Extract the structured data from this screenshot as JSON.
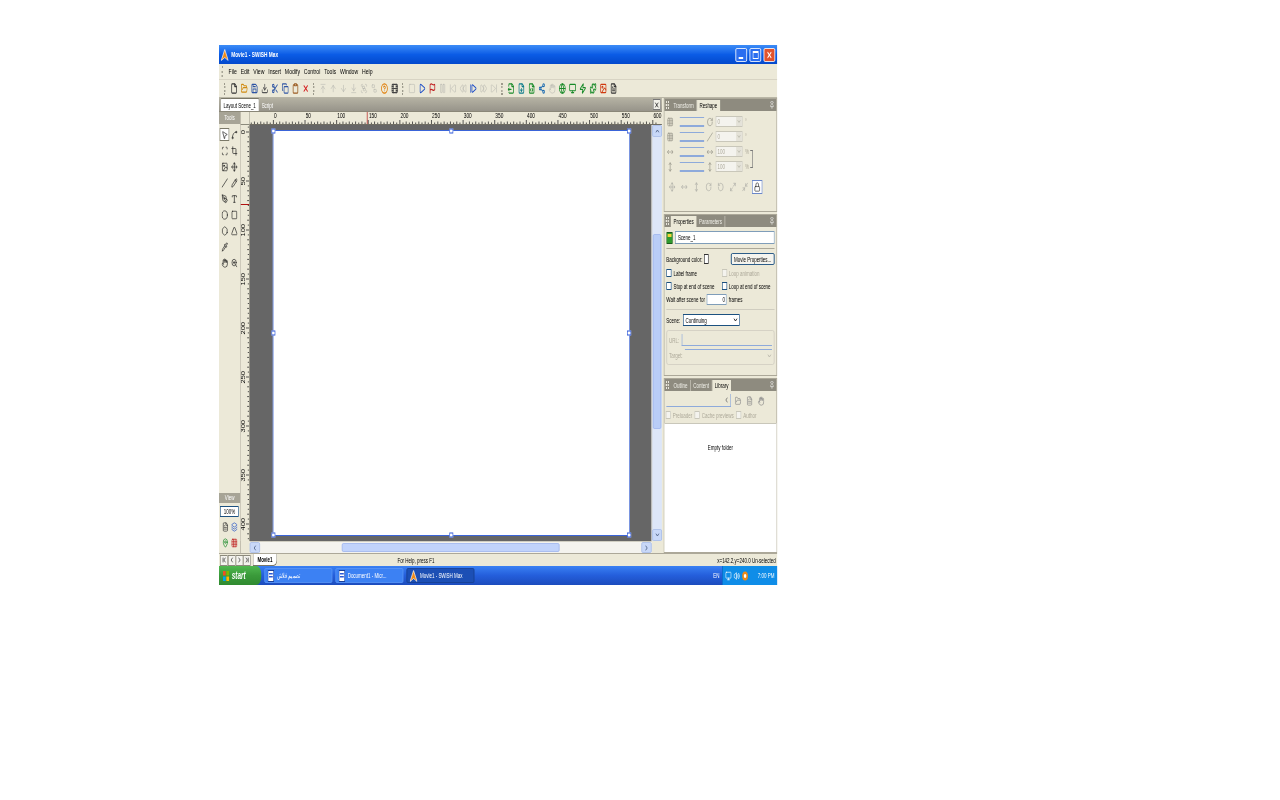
{
  "window": {
    "title": "Movie1 - SWiSH Max"
  },
  "menu": [
    "File",
    "Edit",
    "View",
    "Insert",
    "Modify",
    "Control",
    "Tools",
    "Window",
    "Help"
  ],
  "toolbar": [
    [
      {
        "disabled": false
      },
      {
        "disabled": false
      },
      {
        "disabled": false
      },
      {
        "disabled": false
      },
      {
        "disabled": false
      },
      {
        "disabled": false
      },
      {
        "disabled": false
      },
      {
        "disabled": false
      }
    ],
    [
      {
        "disabled": true
      },
      {
        "disabled": true
      },
      {
        "disabled": true
      },
      {
        "disabled": true
      },
      {
        "disabled": true
      },
      {
        "disabled": true
      },
      {
        "disabled": false
      },
      {
        "disabled": false
      }
    ],
    [
      {
        "disabled": true
      },
      {
        "disabled": false
      },
      {
        "disabled": false
      },
      {
        "disabled": true
      },
      {
        "disabled": true
      },
      {
        "disabled": true
      },
      {
        "disabled": false
      },
      {
        "disabled": true
      },
      {
        "disabled": true
      }
    ],
    [
      {
        "disabled": false
      },
      {
        "disabled": false
      },
      {
        "disabled": false
      },
      {
        "disabled": false
      },
      {
        "disabled": true
      },
      {
        "disabled": false
      },
      {
        "disabled": false
      },
      {
        "disabled": false
      },
      {
        "disabled": false
      },
      {
        "disabled": false
      },
      {
        "disabled": false
      }
    ]
  ],
  "document_tabs": [
    {
      "label": "Layout Scene_1",
      "selected": true
    },
    {
      "label": "Script",
      "selected": false
    }
  ],
  "tools": {
    "title": "Tools",
    "items": [
      {
        "selected": true
      },
      {
        "selected": false
      },
      {
        "selected": false
      },
      {
        "selected": false
      },
      {
        "selected": false
      },
      {
        "selected": false
      },
      {
        "selected": false
      },
      {
        "selected": false
      },
      {
        "selected": false
      },
      {
        "selected": false
      },
      {
        "selected": false
      },
      {
        "selected": false
      },
      {
        "selected": false
      },
      {
        "selected": false
      },
      {
        "selected": false
      },
      {
        "selected": false
      },
      {
        "selected": false
      }
    ]
  },
  "view": {
    "title": "View",
    "zoom": "100%"
  },
  "horizontal_ruler": [
    "0",
    "50",
    "100",
    "150",
    "200",
    "250",
    "300",
    "350",
    "400",
    "450",
    "500",
    "550",
    "600"
  ],
  "vertical_ruler": [
    "0",
    "50",
    "100",
    "150",
    "200",
    "250",
    "300",
    "350",
    "400"
  ],
  "stage": {
    "selected": true
  },
  "transform_panel": {
    "tabs": [
      {
        "label": "Transform",
        "selected": false
      },
      {
        "label": "Reshape",
        "selected": true
      }
    ],
    "rows": [
      {
        "value": "0",
        "unit": "°",
        "disabled": true
      },
      {
        "value": "0",
        "unit": "°",
        "disabled": true
      },
      {
        "value": "100",
        "unit": "%",
        "disabled": true
      },
      {
        "value": "100",
        "unit": "%",
        "disabled": true
      }
    ],
    "tools": [
      {
        "disabled": true
      },
      {
        "disabled": true
      },
      {
        "disabled": true
      },
      {
        "disabled": true
      },
      {
        "disabled": true
      },
      {
        "disabled": true
      },
      {
        "disabled": true
      },
      {
        "disabled": false
      }
    ]
  },
  "properties_panel": {
    "tabs": [
      {
        "label": "Properties",
        "selected": true
      },
      {
        "label": "Parameters",
        "selected": false
      }
    ],
    "name": "Scene_1",
    "background_label": "Background color:",
    "movie_properties_button": "Movie Properties...",
    "checkboxes": [
      {
        "label": "Label frame",
        "checked": false,
        "disabled": false
      },
      {
        "label": "Loop animation",
        "checked": false,
        "disabled": true
      },
      {
        "label": "Stop at end of scene",
        "checked": false,
        "disabled": false
      },
      {
        "label": "Loop at end of scene",
        "checked": false,
        "disabled": false
      }
    ],
    "wait": {
      "label": "Wait after scene for",
      "value": "0",
      "unit": "frames"
    },
    "scene_mode": {
      "label": "Scene:",
      "value": "Continuing"
    },
    "url": {
      "label": "URL:",
      "disabled": true
    },
    "target": {
      "label": "Target:",
      "disabled": true
    }
  },
  "library_panel": {
    "tabs": [
      {
        "label": "Outline",
        "selected": false
      },
      {
        "label": "Content",
        "selected": false
      },
      {
        "label": "Library",
        "selected": true
      }
    ],
    "checkboxes": [
      {
        "label": "Preloader",
        "checked": false,
        "disabled": true
      },
      {
        "label": "Cache previews",
        "checked": false,
        "disabled": true
      },
      {
        "label": "Author",
        "checked": false,
        "disabled": true
      }
    ],
    "empty_message": "Empty folder"
  },
  "movie_tabs": [
    {
      "label": "Movie1",
      "selected": true
    }
  ],
  "status_bar": {
    "message": "For Help, press F1",
    "coordinates": "x=142.2,y=240.0 Un-selected"
  },
  "taskbar": {
    "start": "start",
    "tasks": [
      {
        "label": "تصميم فلاش",
        "selected": false
      },
      {
        "label": "Document1 - Micr...",
        "selected": false
      },
      {
        "label": "Movie1 - SWiSH Max",
        "selected": true
      }
    ],
    "language": "EN",
    "clock": "7:00 PM"
  }
}
